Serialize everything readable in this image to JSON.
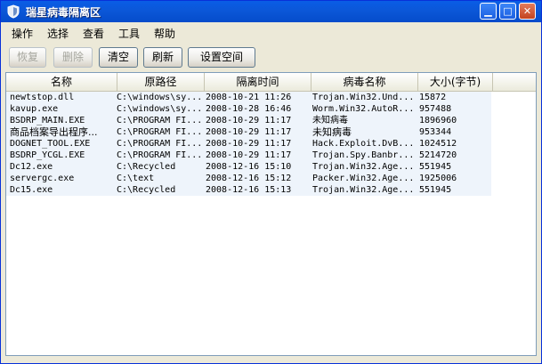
{
  "window": {
    "title": "瑞星病毒隔离区"
  },
  "menu": [
    "操作",
    "选择",
    "查看",
    "工具",
    "帮助"
  ],
  "toolbar": {
    "restore": "恢复",
    "delete": "删除",
    "clear": "清空",
    "refresh": "刷新",
    "settings": "设置空间"
  },
  "columns": [
    "名称",
    "原路径",
    "隔离时间",
    "病毒名称",
    "大小(字节)"
  ],
  "rows": [
    {
      "name": "newtstop.dll",
      "path": "C:\\windows\\sy...",
      "time": "2008-10-21 11:26",
      "virus": "Trojan.Win32.Und...",
      "size": "15872"
    },
    {
      "name": "kavup.exe",
      "path": "C:\\windows\\sy...",
      "time": "2008-10-28 16:46",
      "virus": "Worm.Win32.AutoR...",
      "size": "957488"
    },
    {
      "name": "BSDRP_MAIN.EXE",
      "path": "C:\\PROGRAM FI...",
      "time": "2008-10-29 11:17",
      "virus": "未知病毒",
      "size": "1896960"
    },
    {
      "name": "商品档案导出程序...",
      "path": "C:\\PROGRAM FI...",
      "time": "2008-10-29 11:17",
      "virus": "未知病毒",
      "size": "953344"
    },
    {
      "name": "DOGNET_TOOL.EXE",
      "path": "C:\\PROGRAM FI...",
      "time": "2008-10-29 11:17",
      "virus": "Hack.Exploit.DvB...",
      "size": "1024512"
    },
    {
      "name": "BSDRP_YCGL.EXE",
      "path": "C:\\PROGRAM FI...",
      "time": "2008-10-29 11:17",
      "virus": "Trojan.Spy.Banbr...",
      "size": "5214720"
    },
    {
      "name": "Dc12.exe",
      "path": "C:\\Recycled",
      "time": "2008-12-16 15:10",
      "virus": "Trojan.Win32.Age...",
      "size": "551945"
    },
    {
      "name": "servergc.exe",
      "path": "C:\\text",
      "time": "2008-12-16 15:12",
      "virus": "Packer.Win32.Age...",
      "size": "1925006"
    },
    {
      "name": "Dc15.exe",
      "path": "C:\\Recycled",
      "time": "2008-12-16 15:13",
      "virus": "Trojan.Win32.Age...",
      "size": "551945"
    }
  ]
}
